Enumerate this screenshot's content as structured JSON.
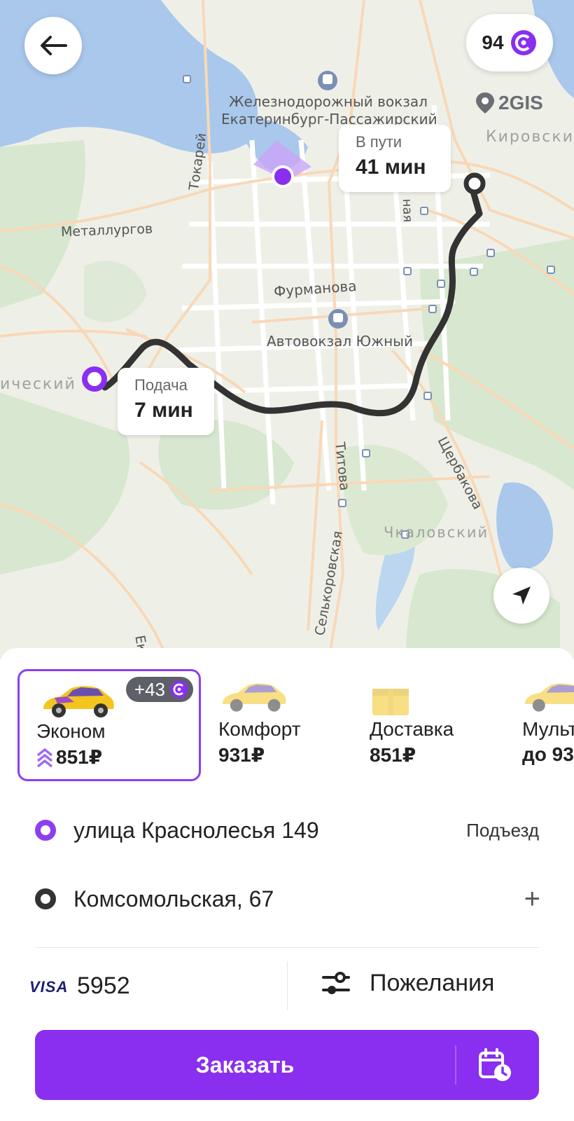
{
  "map": {
    "bonus_points": "94",
    "provider": "2GIS",
    "labels": {
      "station_line1": "Железнодорожный вокзал",
      "station_line2": "Екатеринбург-Пассажирский",
      "kirovsky": "Кировский",
      "tokarey": "Токарей",
      "metallurgov": "Металлургов",
      "furmanova": "Фурманова",
      "bus_station": "Автовокзал Южный",
      "nicheskiy": "ический",
      "titova": "Титова",
      "shcherbakova": "Щербакова",
      "chkalovsky": "Чкаловский",
      "selkorovskaya": "Селькоровская",
      "naya": "ная",
      "ek": "Ек"
    },
    "trip_bubble": {
      "caption": "В пути",
      "value": "41 мин"
    },
    "pickup_bubble": {
      "caption": "Подача",
      "value": "7 мин"
    }
  },
  "tariffs": [
    {
      "name": "Эконом",
      "price": "851₽",
      "selected": true,
      "badge": "+43"
    },
    {
      "name": "Комфорт",
      "price": "931₽",
      "selected": false
    },
    {
      "name": "Доставка",
      "price": "851₽",
      "selected": false
    },
    {
      "name": "Мульт",
      "price": "до 93",
      "selected": false
    }
  ],
  "route": {
    "from": "улица Краснолесья 149",
    "from_action": "Подъезд",
    "to": "Комсомольская, 67",
    "to_action": "+"
  },
  "payment": {
    "card_brand": "VISA",
    "card_last4": "5952",
    "wishes_label": "Пожелания"
  },
  "order_button": {
    "label": "Заказать"
  },
  "colors": {
    "accent": "#8a2ef0",
    "route": "#333333"
  }
}
